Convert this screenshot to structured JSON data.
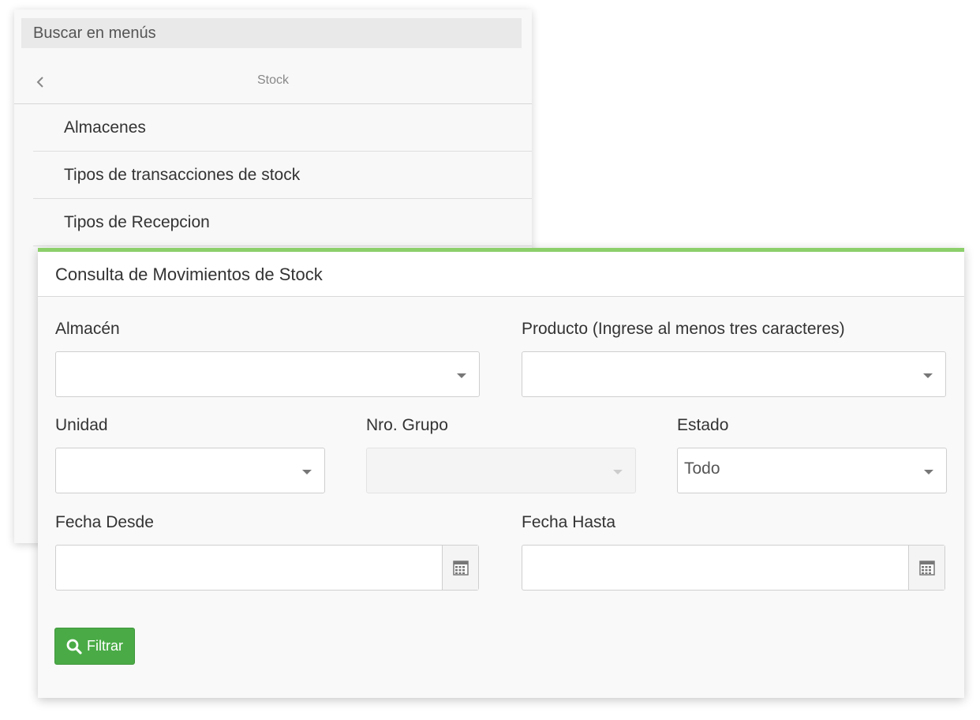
{
  "menu": {
    "search_placeholder": "Buscar en menús",
    "back_icon": "chevron-left-icon",
    "title": "Stock",
    "items": [
      {
        "label": "Almacenes"
      },
      {
        "label": "Tipos de transacciones de stock"
      },
      {
        "label": "Tipos de Recepcion"
      }
    ]
  },
  "form": {
    "title": "Consulta de Movimientos de Stock",
    "accent_color": "#8bcf6a",
    "fields": {
      "almacen": {
        "label": "Almacén",
        "value": ""
      },
      "producto": {
        "label": "Producto (Ingrese al menos tres caracteres)",
        "value": ""
      },
      "unidad": {
        "label": "Unidad",
        "value": ""
      },
      "nro_grupo": {
        "label": "Nro. Grupo",
        "value": "",
        "disabled": true
      },
      "estado": {
        "label": "Estado",
        "value": "Todo"
      },
      "fecha_desde": {
        "label": "Fecha Desde",
        "value": "",
        "icon": "calendar-icon"
      },
      "fecha_hasta": {
        "label": "Fecha Hasta",
        "value": "",
        "icon": "calendar-icon"
      }
    },
    "filter_button": {
      "label": "Filtrar",
      "icon": "search-icon",
      "color": "#4aab46"
    }
  }
}
